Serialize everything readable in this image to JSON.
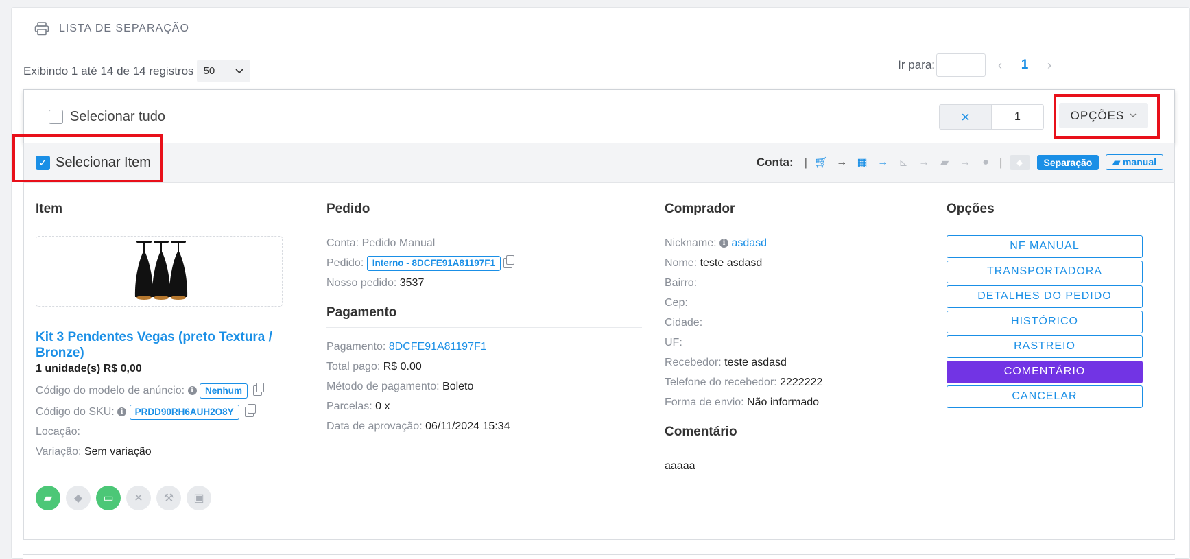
{
  "header": {
    "title": "LISTA DE SEPARAÇÃO",
    "icon": "printer-icon"
  },
  "pagination": {
    "info": "Exibindo 1 até 14 de 14 registros",
    "page_size": "50",
    "goto_label": "Ir para:",
    "goto_value": "",
    "current_page": "1"
  },
  "toolbar": {
    "select_all_label": "Selecionar tudo",
    "select_all_checked": false,
    "quantity": "1",
    "clear_symbol": "×",
    "options_label": "OPÇÕES"
  },
  "item_header": {
    "select_item_label": "Selecionar Item",
    "checked": true,
    "conta_label": "Conta:",
    "flow": [
      "cart-icon",
      "boxes-icon",
      "dolly-icon",
      "truck-icon",
      "check-circle-icon"
    ],
    "badge_separacao": "Separação",
    "badge_manual": "manual"
  },
  "item": {
    "heading": "Item",
    "title": "Kit 3 Pendentes Vegas (preto Textura / Bronze)",
    "units_price": "1 unidade(s) R$ 0,00",
    "modelo_label": "Código do modelo de anúncio:",
    "modelo_value": "Nenhum",
    "sku_label": "Código do SKU:",
    "sku_value": "PRDD90RH6AUH2O8Y",
    "locacao_label": "Locação:",
    "locacao_value": "",
    "variacao_label": "Variação:",
    "variacao_value": "Sem variação",
    "status_icons": [
      "truck-icon",
      "diamond-icon",
      "card-icon",
      "x-icon",
      "hammer-icon",
      "box-icon"
    ]
  },
  "pedido": {
    "heading": "Pedido",
    "conta_label": "Conta:",
    "conta_value": "Pedido Manual",
    "pedido_label": "Pedido:",
    "pedido_value": "Interno - 8DCFE91A81197F1",
    "nosso_label": "Nosso pedido:",
    "nosso_value": "3537"
  },
  "pagamento": {
    "heading": "Pagamento",
    "pagamento_label": "Pagamento:",
    "pagamento_value": "8DCFE91A81197F1",
    "total_label": "Total pago:",
    "total_value": "R$ 0.00",
    "metodo_label": "Método de pagamento:",
    "metodo_value": "Boleto",
    "parcelas_label": "Parcelas:",
    "parcelas_value": "0 x",
    "data_label": "Data de aprovação:",
    "data_value": "06/11/2024 15:34"
  },
  "comprador": {
    "heading": "Comprador",
    "nickname_label": "Nickname:",
    "nickname_value": "asdasd",
    "nome_label": "Nome:",
    "nome_value": "teste asdasd",
    "bairro_label": "Bairro:",
    "cep_label": "Cep:",
    "cidade_label": "Cidade:",
    "uf_label": "UF:",
    "recebedor_label": "Recebedor:",
    "recebedor_value": "teste asdasd",
    "telefone_label": "Telefone do recebedor:",
    "telefone_value": "2222222",
    "envio_label": "Forma de envio:",
    "envio_value": "Não informado"
  },
  "comentario": {
    "heading": "Comentário",
    "text": "aaaaa"
  },
  "opcoes": {
    "heading": "Opções",
    "buttons": [
      "NF MANUAL",
      "TRANSPORTADORA",
      "DETALHES DO PEDIDO",
      "HISTÓRICO",
      "RASTREIO",
      "COMENTÁRIO",
      "CANCELAR"
    ]
  },
  "colors": {
    "accent": "#1a8fe6",
    "purple": "#7234e4",
    "green": "#4cc777",
    "highlight": "#e8101a"
  }
}
